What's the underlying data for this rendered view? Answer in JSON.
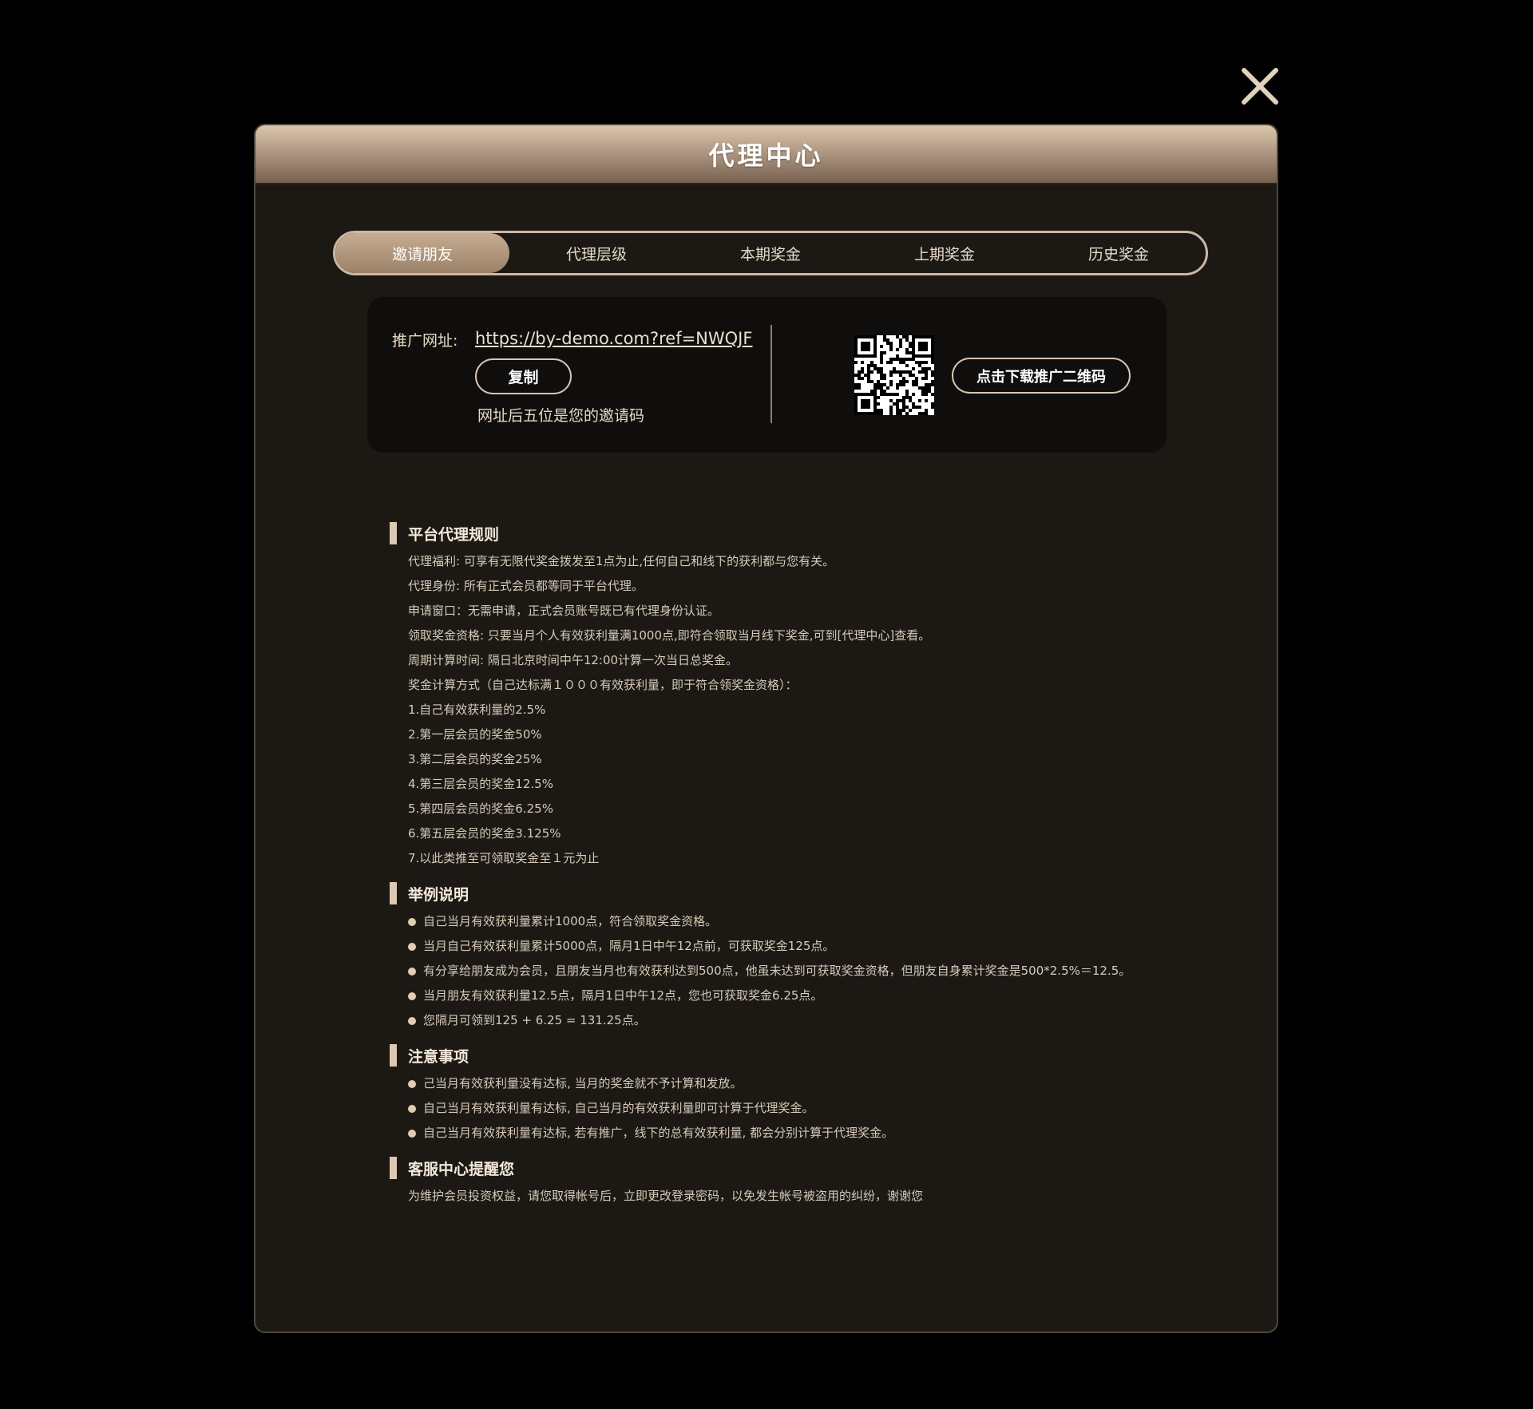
{
  "modal": {
    "title": "代理中心",
    "close_icon": "close-icon"
  },
  "tabs": [
    {
      "label": "邀请朋友",
      "active": true
    },
    {
      "label": "代理层级",
      "active": false
    },
    {
      "label": "本期奖金",
      "active": false
    },
    {
      "label": "上期奖金",
      "active": false
    },
    {
      "label": "历史奖金",
      "active": false
    }
  ],
  "invite": {
    "label": "推广网址:",
    "url": "https://by-demo.com?ref=NWQJF",
    "copy_label": "复制",
    "hint": "网址后五位是您的邀请码",
    "download_label": "点击下载推广二维码",
    "qr_icon": "qr-code-icon"
  },
  "rules": [
    {
      "title": "平台代理规则",
      "bulleted": false,
      "lines": [
        "代理福利: 可享有无限代奖金拨发至1点为止,任何自己和线下的获利都与您有关。",
        "代理身份: 所有正式会员都等同于平台代理。",
        "申请窗口：无需申请，正式会员账号既已有代理身份认证。",
        "领取奖金资格: 只要当月个人有效获利量满1000点,即符合领取当月线下奖金,可到[代理中心]查看。",
        "周期计算时间: 隔日北京时间中午12:00计算一次当日总奖金。",
        "奖金计算方式（自己达标满１０００有效获利量，即于符合领奖金资格）：",
        "1.自己有效获利量的2.5%",
        "2.第一层会员的奖金50%",
        "3.第二层会员的奖金25%",
        "4.第三层会员的奖金12.5%",
        "5.第四层会员的奖金6.25%",
        "6.第五层会员的奖金3.125%",
        "7.以此类推至可领取奖金至１元为止"
      ]
    },
    {
      "title": "举例说明",
      "bulleted": true,
      "lines": [
        "自己当月有效获利量累计1000点，符合领取奖金资格。",
        "当月自己有效获利量累计5000点，隔月1日中午12点前，可获取奖金125点。",
        "有分享给朋友成为会员，且朋友当月也有效获利达到500点，他虽未达到可获取奖金资格，但朋友自身累计奖金是500*2.5%＝12.5。",
        "当月朋友有效获利量12.5点，隔月1日中午12点，您也可获取奖金6.25点。",
        "您隔月可领到125 + 6.25 = 131.25点。"
      ]
    },
    {
      "title": "注意事项",
      "bulleted": true,
      "lines": [
        "己当月有效获利量没有达标, 当月的奖金就不予计算和发放。",
        "自己当月有效获利量有达标, 自己当月的有效获利量即可计算于代理奖金。",
        "自己当月有效获利量有达标, 若有推广，线下的总有效获利量, 都会分别计算于代理奖金。"
      ]
    },
    {
      "title": "客服中心提醒您",
      "bulleted": false,
      "lines": [
        "为维护会员投资权益，请您取得帐号后，立即更改登录密码，以免发生帐号被盗用的纠纷，谢谢您"
      ]
    }
  ]
}
